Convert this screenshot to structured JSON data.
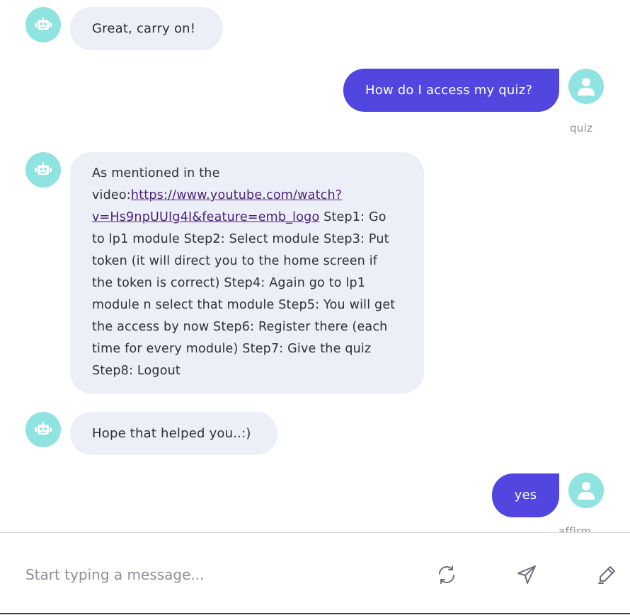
{
  "messages": [
    {
      "sender": "bot",
      "text": "Great, carry on!"
    },
    {
      "sender": "user",
      "text": "How do I access my quiz?",
      "intent": "quiz"
    },
    {
      "sender": "bot",
      "text_before": "As mentioned in the video:",
      "link": "https://www.youtube.com/watch?v=Hs9npUUIg4I&feature=emb_logo",
      "link_line1": "https://www.youtube.com/watch?",
      "link_line2": "v=Hs9npUUIg4I&feature=emb_logo",
      "text_after": " Step1: Go to lp1 module Step2: Select module Step3: Put token (it will direct you to the home screen if the token is correct) Step4: Again go to lp1 module n select that module Step5: You will get the access by now Step6: Register there (each time for every module) Step7: Give the quiz Step8: Logout"
    },
    {
      "sender": "bot",
      "text": "Hope that helped you..:)"
    },
    {
      "sender": "user",
      "text": "yes",
      "intent": "affirm"
    }
  ],
  "composer": {
    "placeholder": "Start typing a message...",
    "value": ""
  },
  "icons": {
    "bot_avatar": "robot-icon",
    "user_avatar": "user-icon",
    "restart": "refresh-icon",
    "send": "send-icon",
    "feedback": "pen-icon"
  },
  "colors": {
    "user_bubble": "#5146e0",
    "bot_bubble": "#eceef8",
    "avatar": "#8fe3e0",
    "link": "#4b2176"
  }
}
